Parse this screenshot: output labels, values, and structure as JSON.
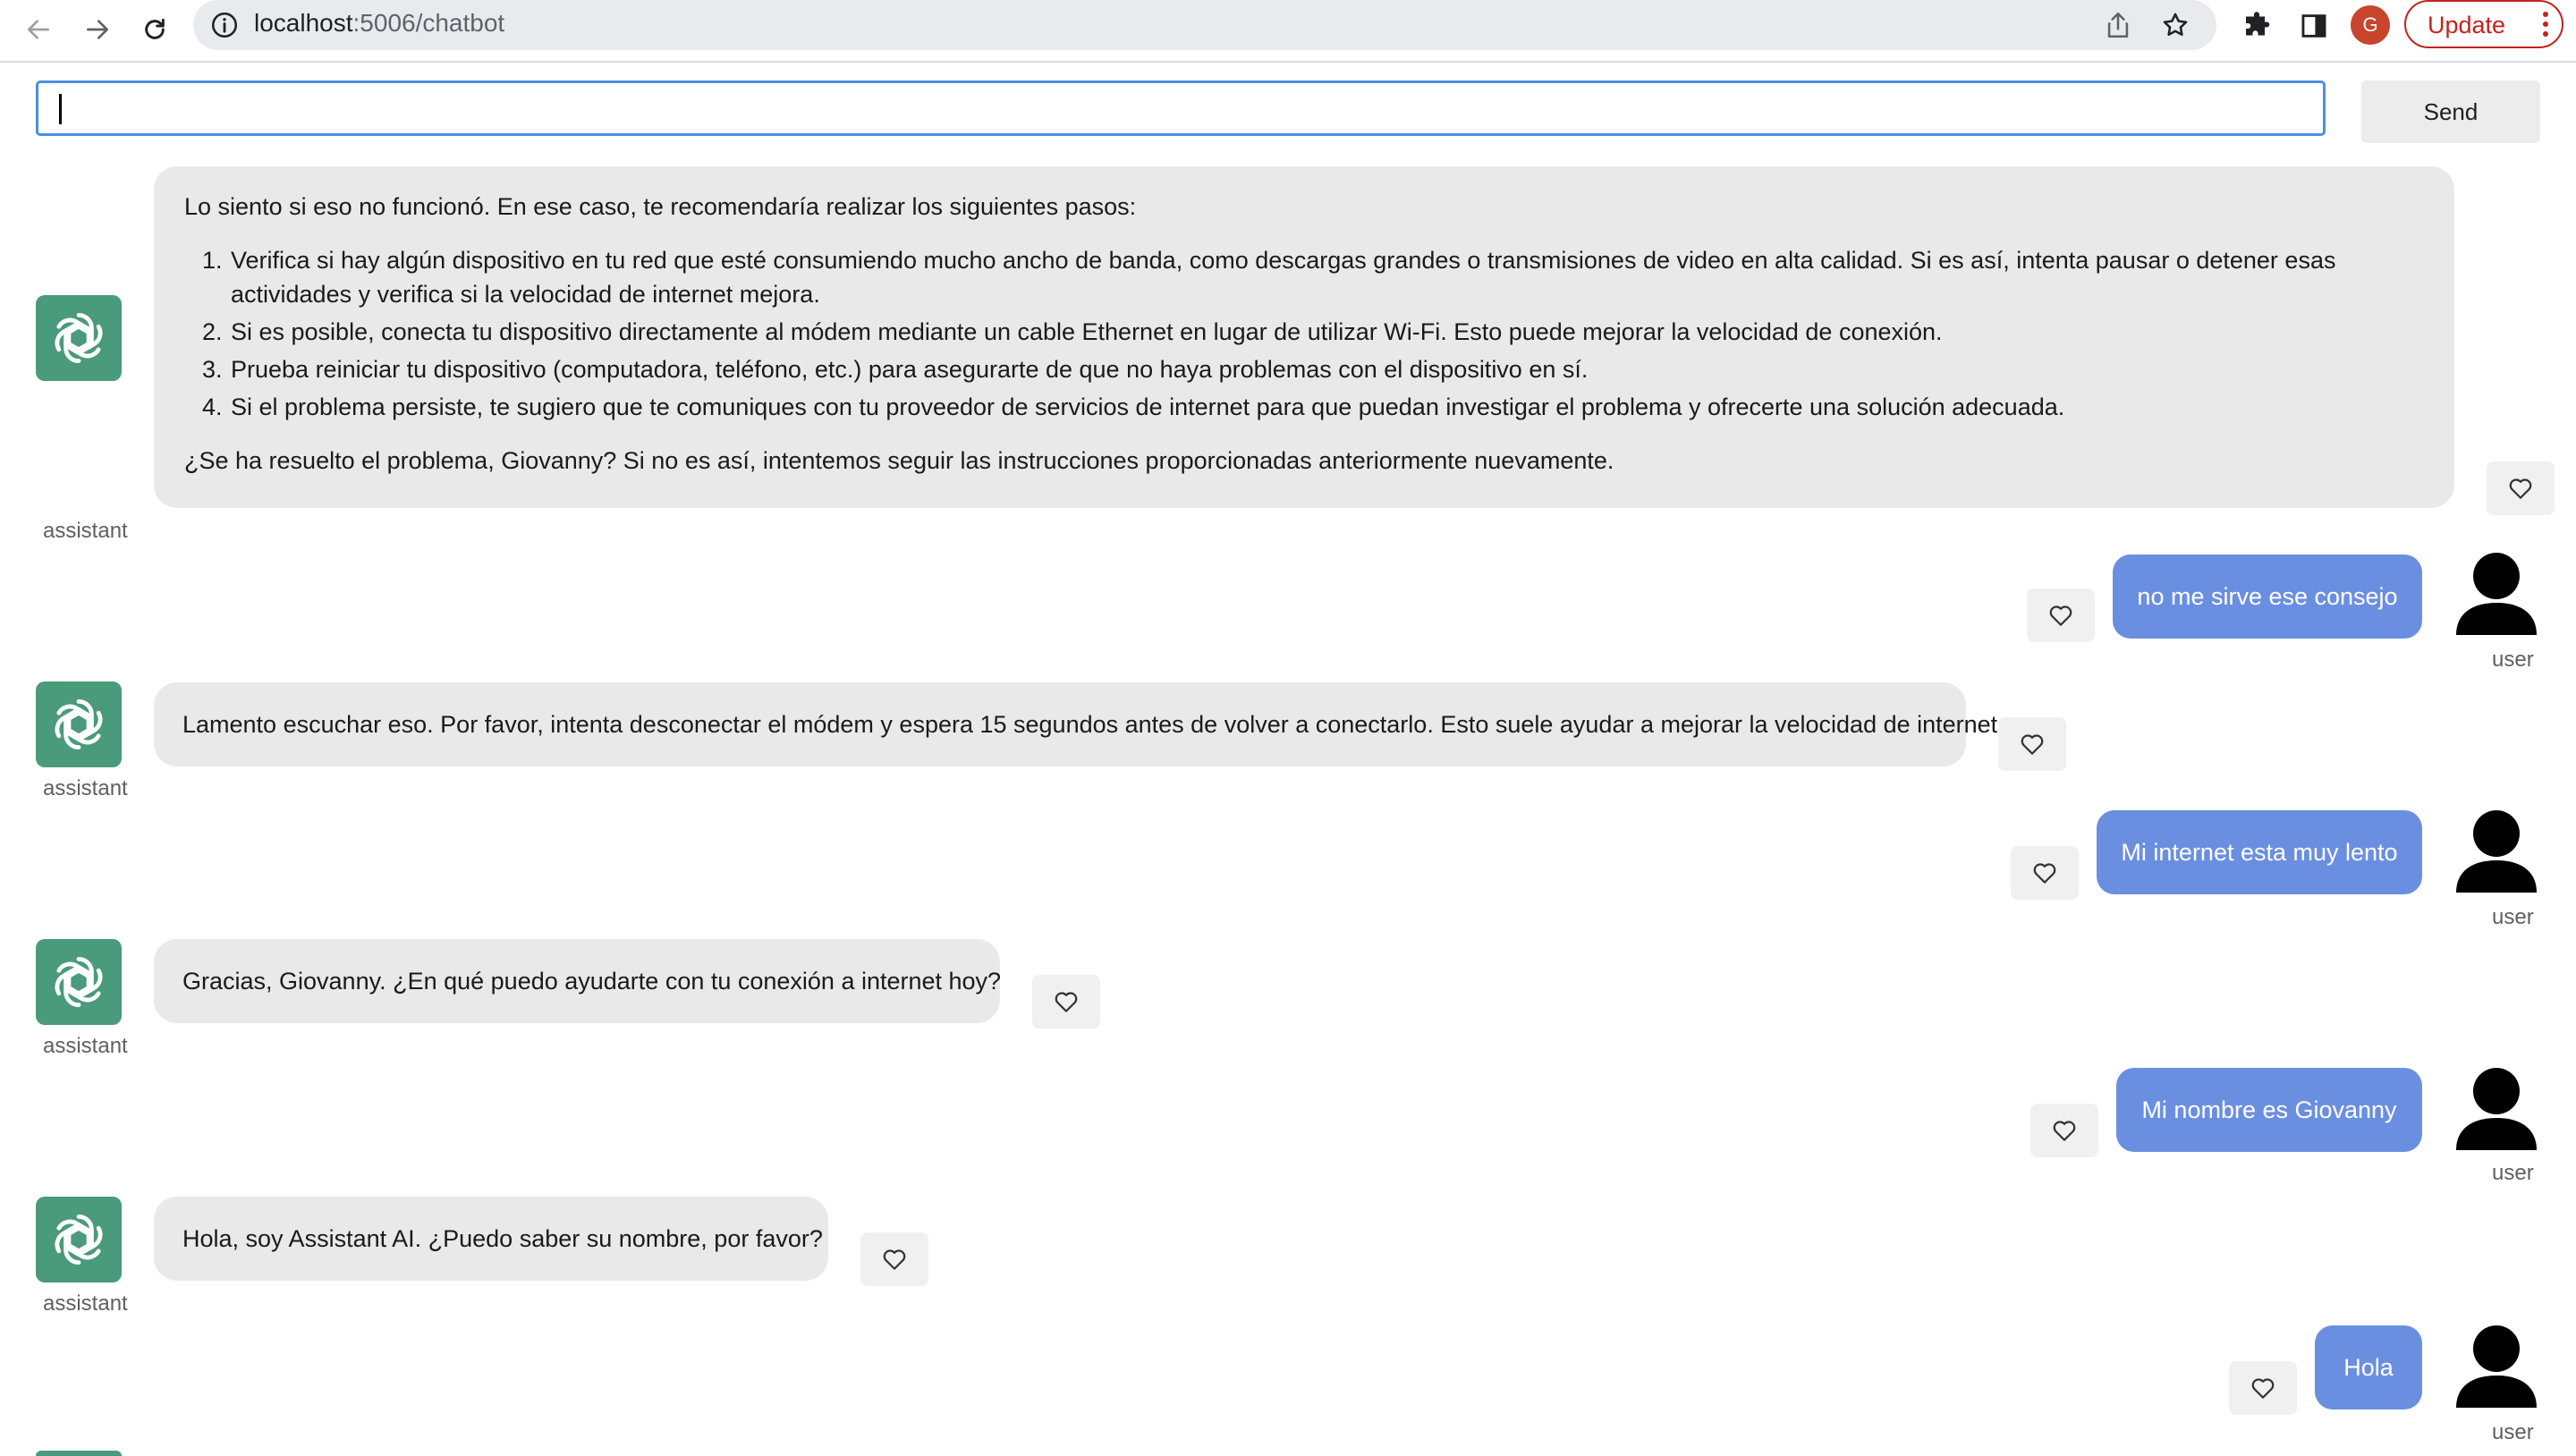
{
  "browser": {
    "url_host": "localhost",
    "url_path": ":5006/chatbot",
    "profile_initial": "G",
    "update_label": "Update"
  },
  "input": {
    "value": "",
    "placeholder": ""
  },
  "send_label": "Send",
  "messages": [
    {
      "role": "assistant",
      "intro": "Lo siento si eso no funcionó. En ese caso, te recomendaría realizar los siguientes pasos:",
      "steps": [
        "Verifica si hay algún dispositivo en tu red que esté consumiendo mucho ancho de banda, como descargas grandes o transmisiones de video en alta calidad. Si es así, intenta pausar o detener esas actividades y verifica si la velocidad de internet mejora.",
        "Si es posible, conecta tu dispositivo directamente al módem mediante un cable Ethernet en lugar de utilizar Wi-Fi. Esto puede mejorar la velocidad de conexión.",
        "Prueba reiniciar tu dispositivo (computadora, teléfono, etc.) para asegurarte de que no haya problemas con el dispositivo en sí.",
        "Si el problema persiste, te sugiero que te comuniques con tu proveedor de servicios de internet para que puedan investigar el problema y ofrecerte una solución adecuada."
      ],
      "outro": "¿Se ha resuelto el problema, Giovanny? Si no es así, intentemos seguir las instrucciones proporcionadas anteriormente nuevamente.",
      "label": "assistant"
    },
    {
      "role": "user",
      "text": "no me sirve ese consejo",
      "label": "user"
    },
    {
      "role": "assistant",
      "text": "Lamento escuchar eso. Por favor, intenta desconectar el módem y espera 15 segundos antes de volver a conectarlo. Esto suele ayudar a mejorar la velocidad de internet.",
      "label": "assistant"
    },
    {
      "role": "user",
      "text": "Mi internet esta muy lento",
      "label": "user"
    },
    {
      "role": "assistant",
      "text": "Gracias, Giovanny. ¿En qué puedo ayudarte con tu conexión a internet hoy?",
      "label": "assistant"
    },
    {
      "role": "user",
      "text": "Mi nombre es Giovanny",
      "label": "user"
    },
    {
      "role": "assistant",
      "text": "Hola, soy Assistant AI. ¿Puedo saber su nombre, por favor?",
      "label": "assistant"
    },
    {
      "role": "user",
      "text": "Hola",
      "label": "user"
    }
  ],
  "icons": {
    "like": "heart-outline-icon",
    "assistant_avatar": "openai-logo-icon",
    "user_avatar": "person-silhouette-icon"
  },
  "colors": {
    "user_bubble": "#6b8fe0",
    "assistant_bubble": "#e9e9e9",
    "assistant_avatar": "#4a9a7c",
    "input_focus": "#4a90e2"
  }
}
